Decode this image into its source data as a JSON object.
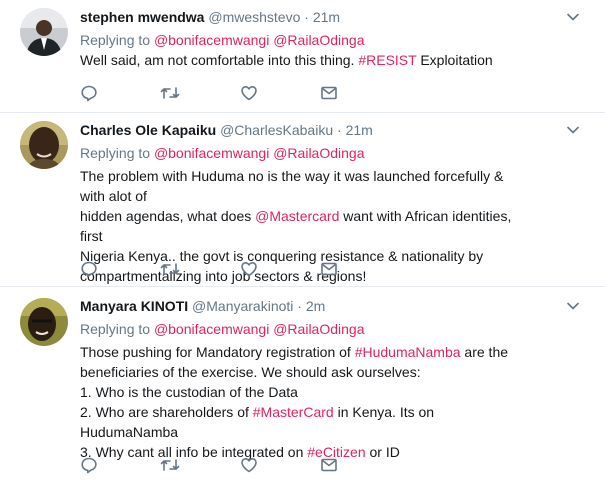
{
  "tweets": [
    {
      "name": "stephen mwendwa",
      "handle": "@mweshstevo",
      "dot": "·",
      "time": "21m",
      "replying_to": "Replying to",
      "mention_1": "@bonifacemwangi",
      "mention_2": "@RailaOdinga",
      "text_1": "Well said, am not comfortable into this thing. ",
      "hashtag": "#RESIST",
      "text_2": " Exploitation"
    },
    {
      "name": "Charles Ole Kapaiku",
      "handle": "@CharlesKabaiku",
      "dot": "·",
      "time": "21m",
      "replying_to": "Replying to",
      "mention_1": "@bonifacemwangi",
      "mention_2": "@RailaOdinga",
      "line_1": "The problem with Huduma no is the way it was launched forcefully & with alot of",
      "line_2a": "hidden agendas, what does ",
      "line_2_mention": "@Mastercard",
      "line_2b": " want with African identities, first",
      "line_3": "Nigeria Kenya.. the govt is conquering resistance & nationality by",
      "line_4": "compartmentalizing into job sectors & regions!"
    },
    {
      "name": "Manyara KINOTI",
      "handle": "@Manyarakinoti",
      "dot": "·",
      "time": "2m",
      "replying_to": "Replying to",
      "mention_1": "@bonifacemwangi",
      "mention_2": "@RailaOdinga",
      "line_1a": "Those pushing for Mandatory registration of ",
      "line_1_tag": "#HudumaNamba",
      "line_1b": " are the",
      "line_2": "beneficiaries of the exercise. We should ask ourselves:",
      "line_3": "1. Who is the custodian of the Data",
      "line_4a": "2. Who are shareholders of ",
      "line_4_tag": "#MasterCard",
      "line_4b": " in Kenya. Its on HudumaNamba",
      "line_5a": "3. Why cant all info be integrated on ",
      "line_5_tag": "#eCitizen",
      "line_5b": " or ID"
    }
  ],
  "icons": [
    "reply-icon",
    "retweet-icon",
    "like-icon",
    "message-icon",
    "chevron-down-icon"
  ],
  "colors": {
    "accent": "#e0245e",
    "secondary_text": "#657786",
    "divider": "#e6ecf0"
  }
}
